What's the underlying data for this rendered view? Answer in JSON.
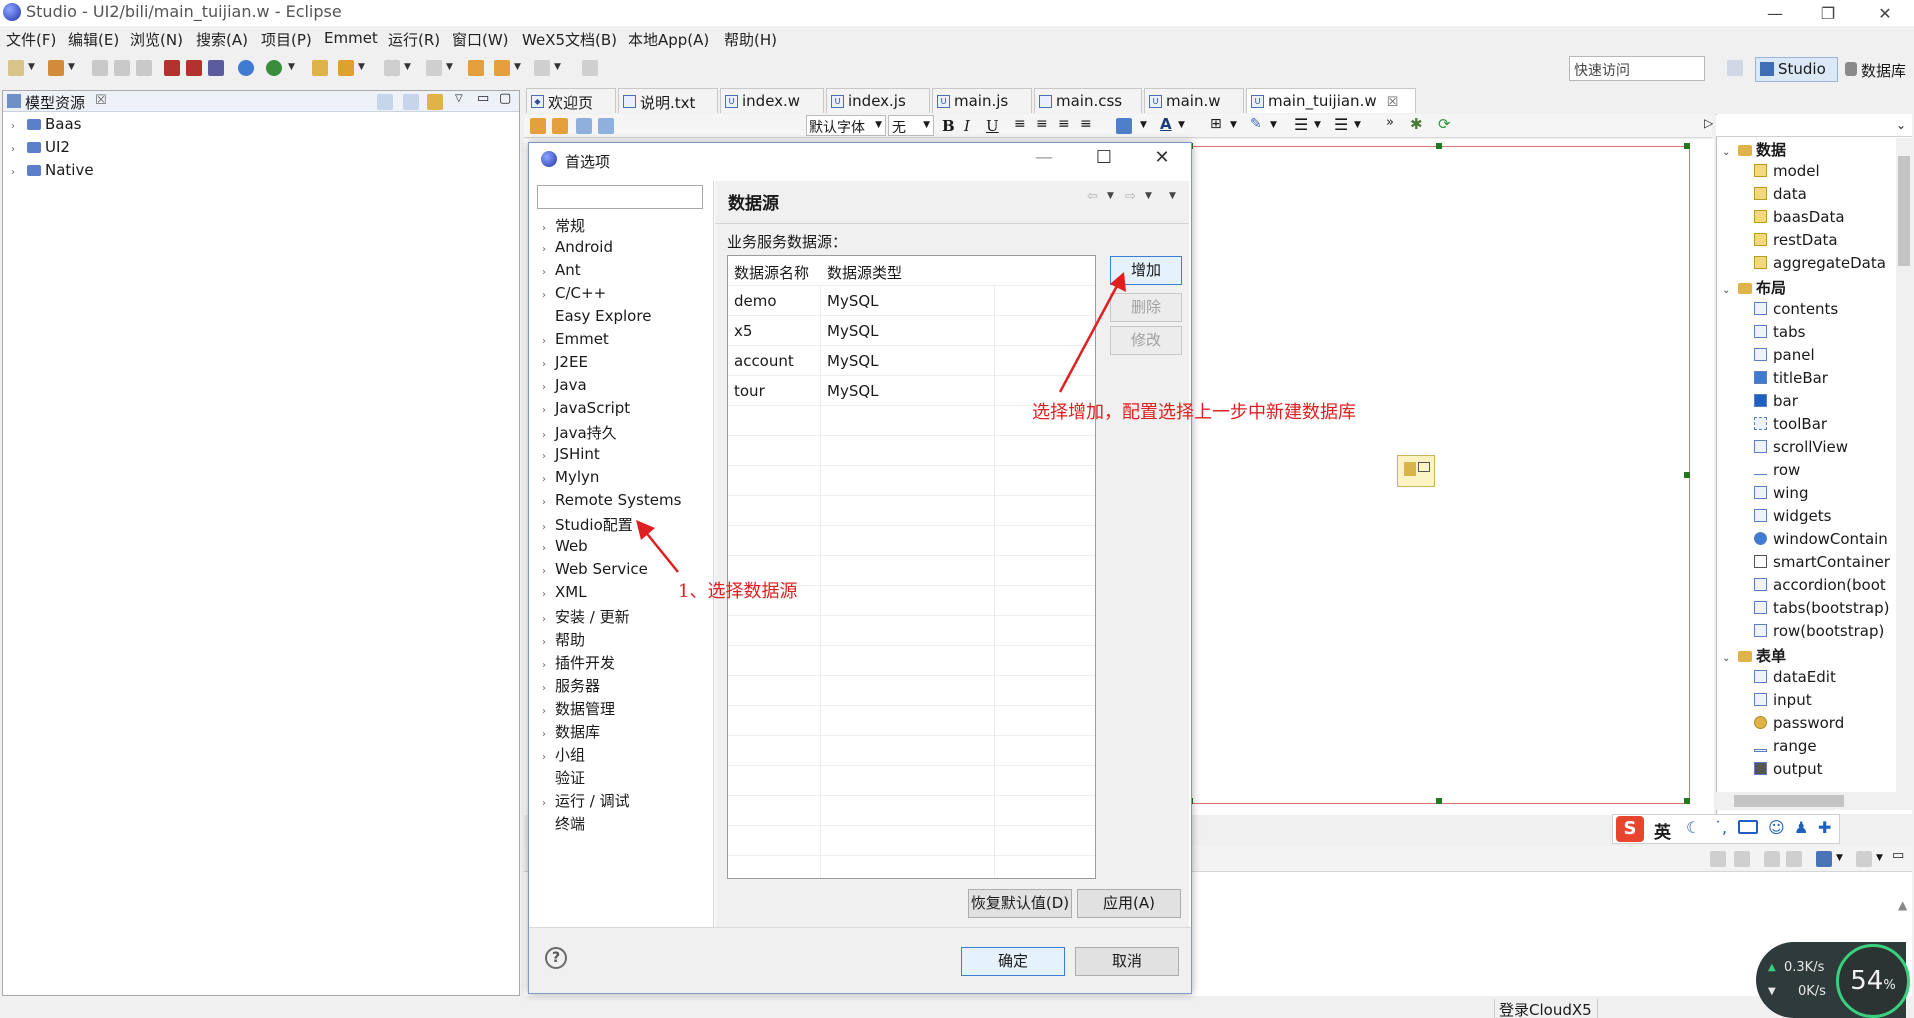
{
  "window": {
    "title": "Studio - UI2/bili/main_tuijian.w - Eclipse",
    "controls": [
      "—",
      "❐",
      "✕"
    ]
  },
  "menu": [
    "文件(F)",
    "编辑(E)",
    "浏览(N)",
    "搜索(A)",
    "项目(P)",
    "Emmet",
    "运行(R)",
    "窗口(W)",
    "WeX5文档(B)",
    "本地App(A)",
    "帮助(H)"
  ],
  "toolbar": {
    "quick_access_placeholder": "快速访问",
    "perspective_studio": "Studio",
    "perspective_db": "数据库"
  },
  "left_panel": {
    "title": "模型资源",
    "close": "☒",
    "tree": [
      "Baas",
      "UI2",
      "Native"
    ]
  },
  "editor": {
    "tabs": [
      "欢迎页",
      "说明.txt",
      "index.w",
      "index.js",
      "main.js",
      "main.css",
      "main.w",
      "main_tuijian.w"
    ],
    "font_select": "默认字体",
    "size_select": "无"
  },
  "palette": {
    "groups": [
      {
        "label": "数据",
        "items": [
          "model",
          "data",
          "baasData",
          "restData",
          "aggregateData"
        ]
      },
      {
        "label": "布局",
        "items": [
          "contents",
          "tabs",
          "panel",
          "titleBar",
          "bar",
          "toolBar",
          "scrollView",
          "row",
          "wing",
          "widgets",
          "windowContain",
          "smartContainer",
          "accordion(boot",
          "tabs(bootstrap)",
          "row(bootstrap)"
        ]
      },
      {
        "label": "表单",
        "items": [
          "dataEdit",
          "input",
          "password",
          "range",
          "output"
        ]
      }
    ]
  },
  "ime": {
    "logo": "S",
    "mode": "英"
  },
  "status": {
    "login": "登录CloudX5"
  },
  "net": {
    "up": "0.3K/s",
    "down": "0K/s",
    "percent": "54",
    "percent_unit": "%"
  },
  "dialog": {
    "title": "首选项",
    "tree": [
      {
        "label": "常规",
        "arrow": true
      },
      {
        "label": "Android",
        "arrow": true
      },
      {
        "label": "Ant",
        "arrow": true
      },
      {
        "label": "C/C++",
        "arrow": true
      },
      {
        "label": "Easy Explore",
        "arrow": false
      },
      {
        "label": "Emmet",
        "arrow": true
      },
      {
        "label": "J2EE",
        "arrow": true
      },
      {
        "label": "Java",
        "arrow": true
      },
      {
        "label": "JavaScript",
        "arrow": true
      },
      {
        "label": "Java持久",
        "arrow": true
      },
      {
        "label": "JSHint",
        "arrow": true
      },
      {
        "label": "Mylyn",
        "arrow": true
      },
      {
        "label": "Remote Systems",
        "arrow": true
      },
      {
        "label": "Studio配置",
        "arrow": true
      },
      {
        "label": "Web",
        "arrow": true
      },
      {
        "label": "Web Service",
        "arrow": true
      },
      {
        "label": "XML",
        "arrow": true
      },
      {
        "label": "安装 / 更新",
        "arrow": true
      },
      {
        "label": "帮助",
        "arrow": true
      },
      {
        "label": "插件开发",
        "arrow": true
      },
      {
        "label": "服务器",
        "arrow": true
      },
      {
        "label": "数据管理",
        "arrow": true
      },
      {
        "label": "数据库",
        "arrow": true
      },
      {
        "label": "小组",
        "arrow": true
      },
      {
        "label": "验证",
        "arrow": false
      },
      {
        "label": "运行 / 调试",
        "arrow": true
      },
      {
        "label": "终端",
        "arrow": false
      }
    ],
    "section_title": "数据源",
    "sub_label": "业务服务数据源：",
    "table": {
      "columns": [
        "数据源名称",
        "数据源类型"
      ],
      "rows": [
        [
          "demo",
          "MySQL"
        ],
        [
          "x5",
          "MySQL"
        ],
        [
          "account",
          "MySQL"
        ],
        [
          "tour",
          "MySQL"
        ]
      ]
    },
    "buttons": {
      "add": "增加",
      "delete": "删除",
      "modify": "修改",
      "restore": "恢复默认值(D)",
      "apply": "应用(A)",
      "ok": "确定",
      "cancel": "取消"
    }
  },
  "annotations": {
    "step1": "1、选择数据源",
    "step2": "选择增加，配置选择上一步中新建数据库"
  },
  "colors": {
    "annotation": "#e02020",
    "accent": "#3b7ed6",
    "design_frame": "#e07070"
  }
}
